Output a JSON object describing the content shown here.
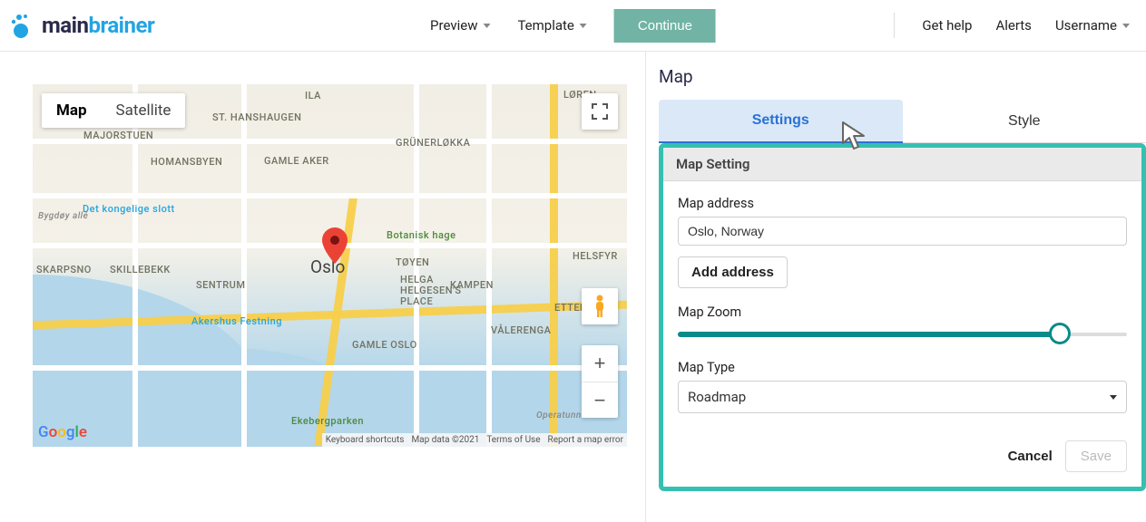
{
  "brand": {
    "main": "main",
    "brainer": "brainer"
  },
  "top": {
    "preview": "Preview",
    "template": "Template",
    "continue": "Continue",
    "help": "Get help",
    "alerts": "Alerts",
    "username": "Username"
  },
  "map": {
    "tabs": {
      "map": "Map",
      "satellite": "Satellite"
    },
    "city": "Oslo",
    "labels": {
      "ila": "ILA",
      "hanshaugen": "ST. HANSHAUGEN",
      "grunerlokka": "GRÜNERLØKKA",
      "majorstuen": "MAJORSTUEN",
      "homansbyen": "HOMANSBYEN",
      "gamleaker": "GAMLE AKER",
      "loren": "LØREN",
      "skillebekk": "SKILLEBEKK",
      "sentrum": "SENTRUM",
      "toyen": "TØYEN",
      "kampen": "KAMPEN",
      "helga": "HELGA\nHELGESEN'S\nPLACE",
      "helsfyr": "HELSFYR",
      "ettersta": "ETTERST",
      "gamleoslo": "GAMLE OSLO",
      "skarpsno": "SKARPSNO",
      "valerenga": "VÅLERENGA",
      "bygdoy": "Bygdøy allé",
      "slott": "Det kongelige slott",
      "botanisk": "Botanisk hage",
      "akershus": "Akershus Festning",
      "ekeberg": "Ekebergparken",
      "opera": "Operatunne"
    },
    "footer": {
      "shortcuts": "Keyboard shortcuts",
      "data": "Map data ©2021",
      "terms": "Terms of Use",
      "report": "Report a map error"
    }
  },
  "panel": {
    "title": "Map",
    "tabs": {
      "settings": "Settings",
      "style": "Style"
    },
    "section": "Map Setting",
    "addressLabel": "Map address",
    "addressValue": "Oslo, Norway",
    "addAddress": "Add address",
    "zoomLabel": "Map Zoom",
    "zoomPercent": 85,
    "typeLabel": "Map Type",
    "typeValue": "Roadmap",
    "cancel": "Cancel",
    "save": "Save"
  }
}
